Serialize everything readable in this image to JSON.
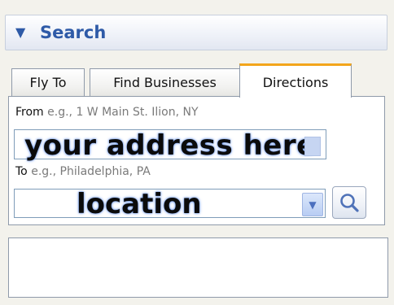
{
  "panel": {
    "title": "Search",
    "arrow": "▼"
  },
  "tabs": [
    {
      "label": "Fly To",
      "active": false
    },
    {
      "label": "Find Businesses",
      "active": false
    },
    {
      "label": "Directions",
      "active": true
    }
  ],
  "directions": {
    "from_label": "From",
    "from_hint": "e.g., 1 W Main St. Ilion, NY",
    "from_value": "your address here",
    "to_label": "To",
    "to_hint": "e.g., Philadelphia, PA",
    "to_value": "location",
    "dropdown_glyph": "▼"
  },
  "icons": {
    "search": "search-icon",
    "dropdown": "chevron-down-icon"
  },
  "colors": {
    "accent": "#2e5aa7",
    "active_tab_top": "#f3a51b"
  }
}
